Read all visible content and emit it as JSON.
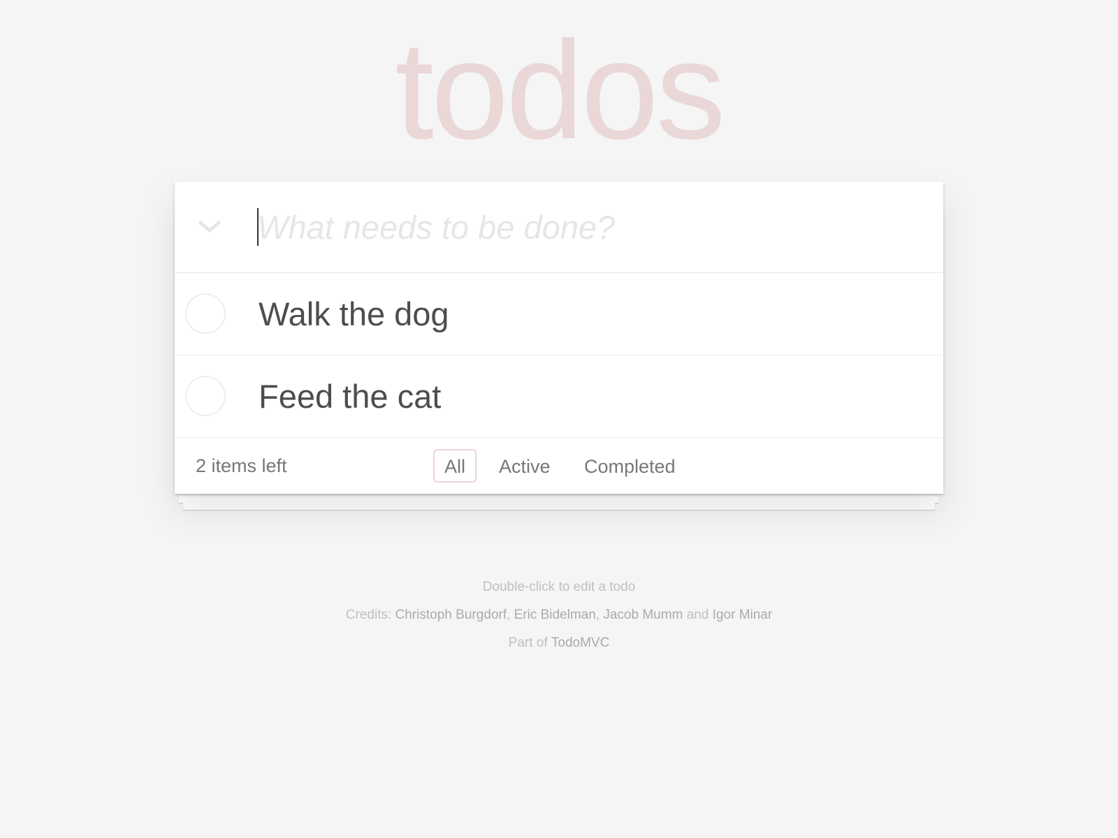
{
  "header": {
    "title": "todos",
    "title_color": "#ead7d7"
  },
  "new_todo": {
    "placeholder": "What needs to be done?",
    "value": "",
    "toggle_icon": "chevron-down-icon"
  },
  "todos": [
    {
      "title": "Walk the dog",
      "completed": false
    },
    {
      "title": "Feed the cat",
      "completed": false
    }
  ],
  "footer": {
    "count_text": "2 items left",
    "filters": [
      {
        "label": "All",
        "selected": true
      },
      {
        "label": "Active",
        "selected": false
      },
      {
        "label": "Completed",
        "selected": false
      }
    ]
  },
  "info": {
    "hint": "Double-click to edit a todo",
    "credits_prefix": "Credits: ",
    "credits": [
      "Christoph Burgdorf",
      "Eric Bidelman",
      "Jacob Mumm",
      "Igor Minar"
    ],
    "credits_sep": ", ",
    "credits_and": " and ",
    "part_of_prefix": "Part of ",
    "part_of_link": "TodoMVC"
  }
}
